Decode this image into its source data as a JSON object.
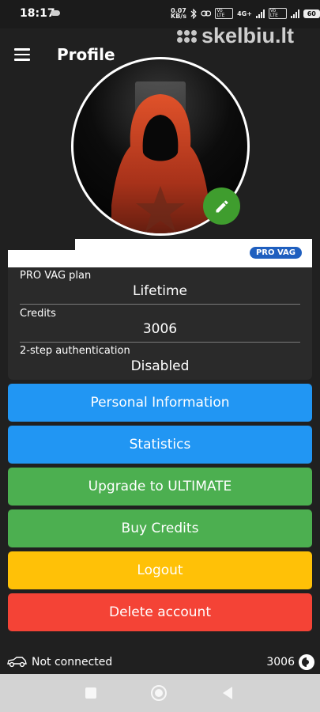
{
  "status_bar": {
    "time": "18:17",
    "net_speed_value": "0.07",
    "net_speed_unit": "KB/s",
    "volte_label": "Vo LTE",
    "network_type": "4G+",
    "battery": "60"
  },
  "watermark": {
    "text": "skelbiu.lt"
  },
  "header": {
    "title": "Profile"
  },
  "profile": {
    "plan_badge": "PRO VAG",
    "fields": [
      {
        "label": "PRO VAG plan",
        "value": "Lifetime"
      },
      {
        "label": "Credits",
        "value": "3006"
      },
      {
        "label": "2-step authentication",
        "value": "Disabled"
      }
    ]
  },
  "buttons": {
    "personal_info": "Personal Information",
    "statistics": "Statistics",
    "upgrade": "Upgrade to ULTIMATE",
    "buy_credits": "Buy Credits",
    "logout": "Logout",
    "delete_account": "Delete account"
  },
  "footer": {
    "connection_status": "Not connected",
    "credits": "3006"
  },
  "colors": {
    "blue_button": "#2196f3",
    "green_button": "#4caf50",
    "yellow_button": "#ffc107",
    "red_button": "#f44336",
    "edit_button": "#3f9d2e",
    "badge": "#1f5fbf",
    "background": "#202020"
  },
  "icons": [
    "menu-icon",
    "pencil-icon",
    "car-icon",
    "coin-icon",
    "cloud-icon",
    "bluetooth-icon",
    "signal-icon",
    "battery-icon"
  ]
}
